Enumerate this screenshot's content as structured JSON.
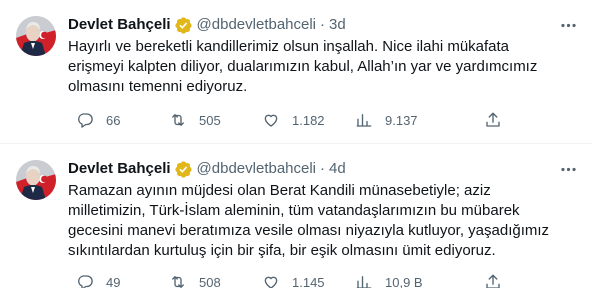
{
  "tweets": [
    {
      "author": {
        "name": "Devlet Bahçeli",
        "handle": "@dbdevletbahceli",
        "verified": true
      },
      "separator": "·",
      "time": "3d",
      "text_lines": [
        "Hayırlı ve bereketli kandillerimiz olsun inşallah. Nice ilahi mükafata",
        "erişmeyi kalpten diliyor, dualarımızın kabul, Allah’ın yar ve yardımcımız",
        "olmasını temenni ediyoruz."
      ],
      "stats": {
        "replies": "66",
        "retweets": "505",
        "likes": "1.182",
        "views": "9.137"
      }
    },
    {
      "author": {
        "name": "Devlet Bahçeli",
        "handle": "@dbdevletbahceli",
        "verified": true
      },
      "separator": "·",
      "time": "4d",
      "text_lines": [
        "Ramazan ayının müjdesi olan Berat Kandili münasebetiyle; aziz",
        "milletimizin, Türk-İslam aleminin, tüm vatandaşlarımızın bu mübarek",
        "gecesini manevi beratımıza vesile olması niyazıyla kutluyor, yaşadığımız",
        "sıkıntılardan kurtuluş için bir şifa, bir eşik olmasını ümit ediyoruz."
      ],
      "stats": {
        "replies": "49",
        "retweets": "508",
        "likes": "1.145",
        "views": "10,9 B"
      }
    }
  ],
  "colors": {
    "text": "#0f1419",
    "secondary": "#536471",
    "verified_gold": "#e2b719",
    "divider": "#eff3f4"
  },
  "icons": [
    "verified-badge-icon",
    "more-icon",
    "reply-icon",
    "retweet-icon",
    "like-icon",
    "views-icon",
    "share-icon"
  ]
}
